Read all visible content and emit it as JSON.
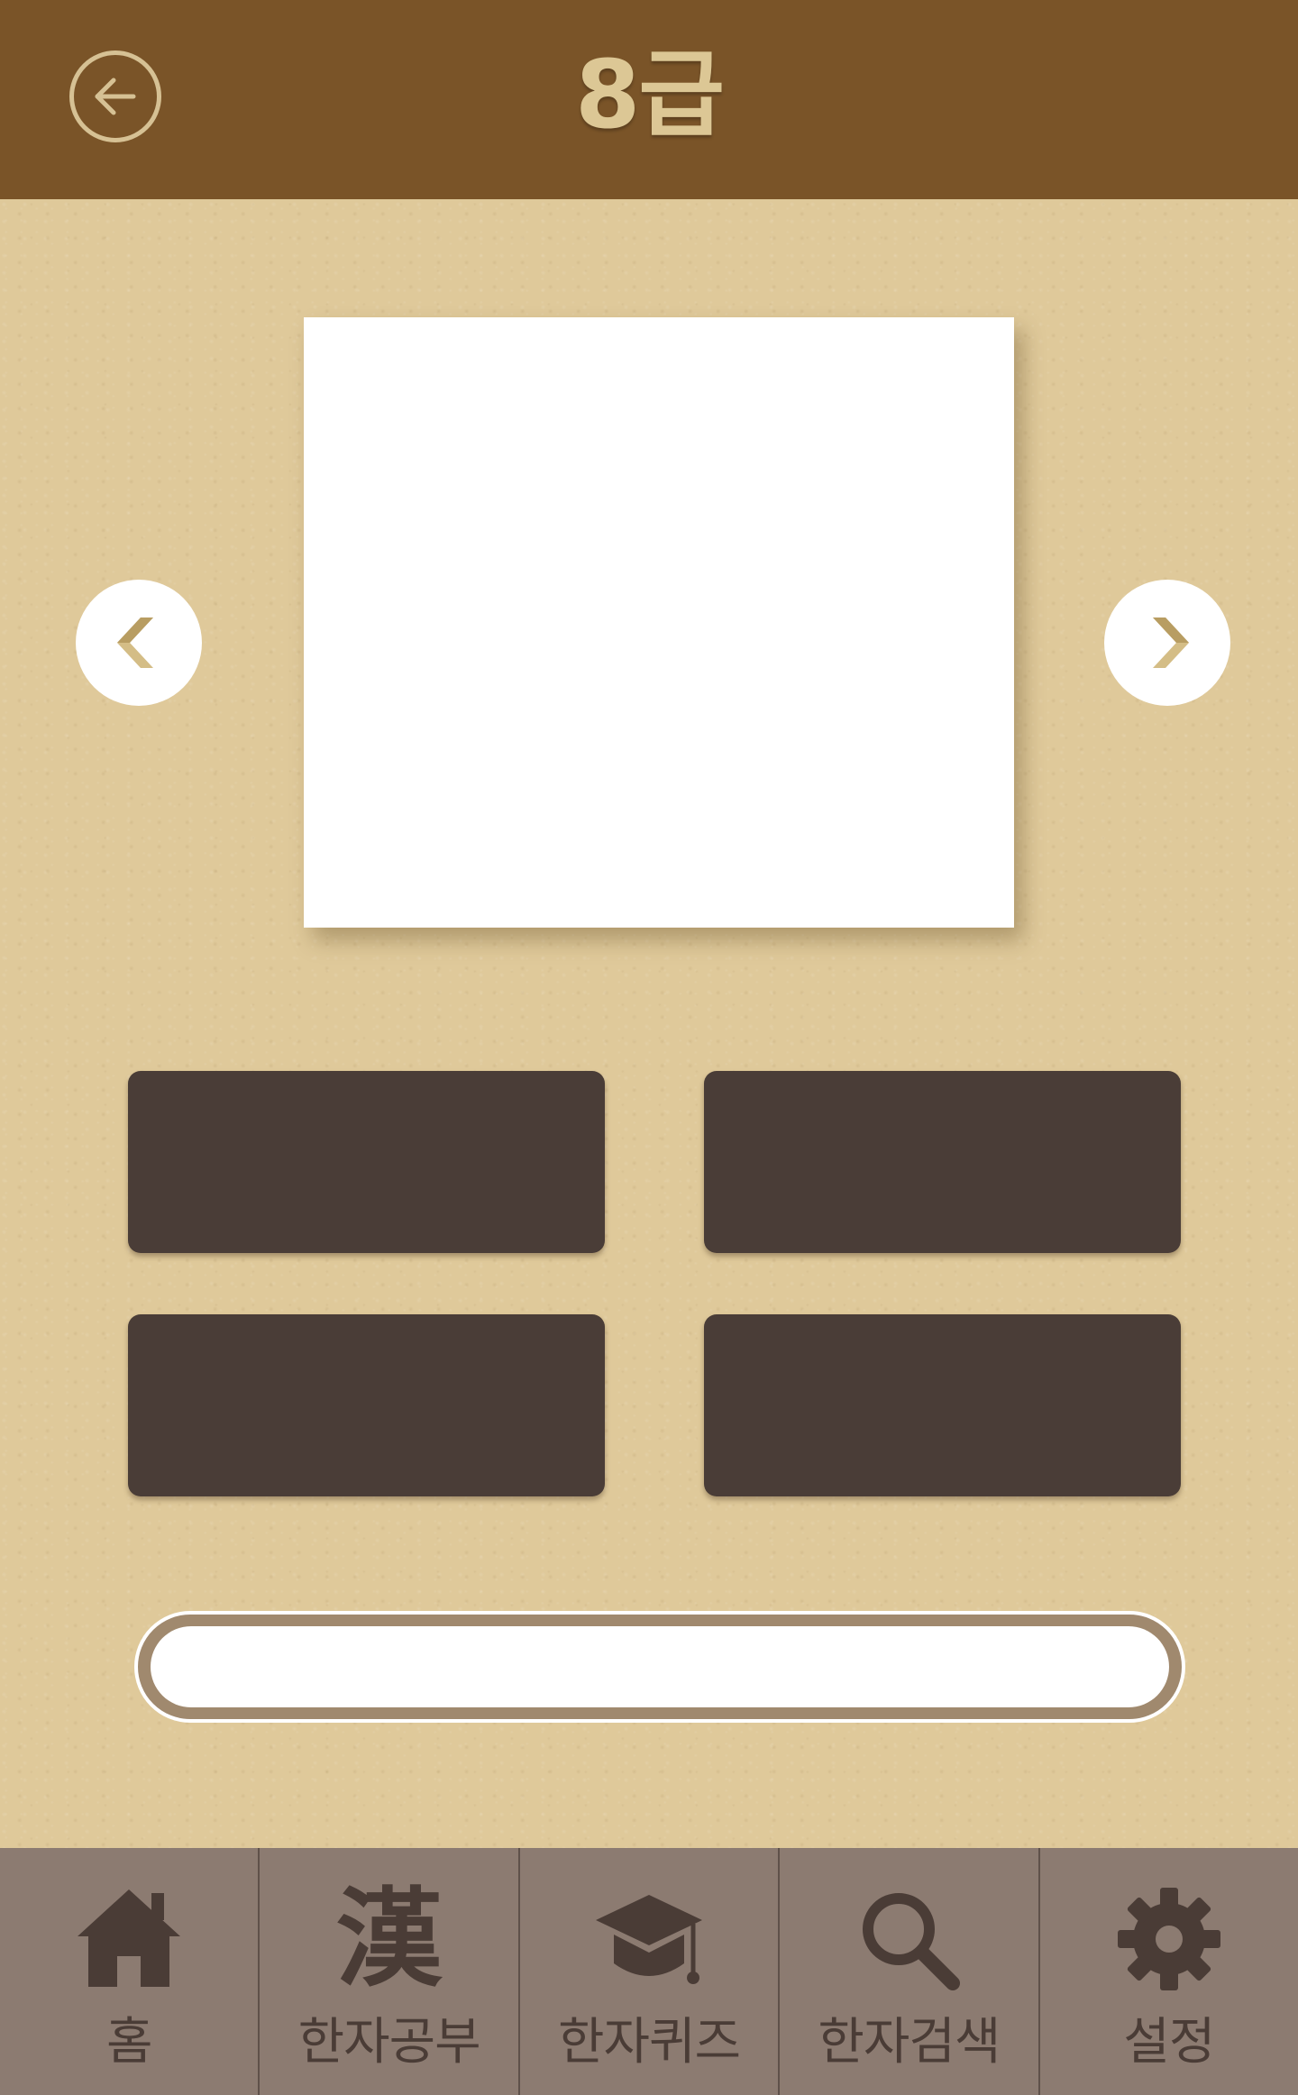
{
  "header": {
    "title": "8급",
    "back_icon": "arrow-left-circle-icon",
    "background_color": "#7a5428",
    "title_color": "#dcc795"
  },
  "quiz": {
    "card_character": "",
    "prev_icon": "chevron-left-icon",
    "next_icon": "chevron-right-icon",
    "answers": [
      "",
      "",
      "",
      ""
    ],
    "answer_button_color": "#4a3d37",
    "progress_fraction": 1.0
  },
  "tabbar": {
    "background_color": "#8c7b71",
    "icon_color": "#4a3c36",
    "items": [
      {
        "label": "홈",
        "icon": "home-icon"
      },
      {
        "label": "한자공부",
        "icon": "hanja-icon",
        "glyph": "漢"
      },
      {
        "label": "한자퀴즈",
        "icon": "graduation-cap-icon"
      },
      {
        "label": "한자검색",
        "icon": "search-icon"
      },
      {
        "label": "설정",
        "icon": "gear-icon"
      }
    ]
  }
}
